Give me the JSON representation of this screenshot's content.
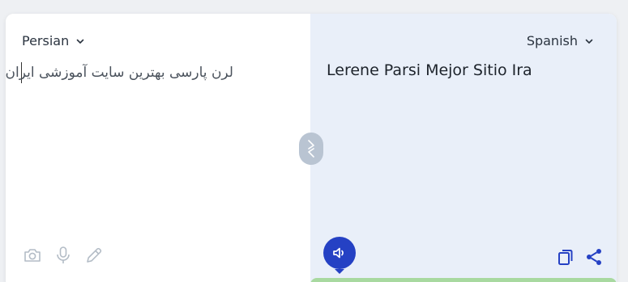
{
  "source": {
    "language": "Persian",
    "text": "لرن پارسی بهترین سایت آموزشی ایران",
    "tools": [
      "camera-icon",
      "microphone-icon",
      "pencil-icon"
    ]
  },
  "target": {
    "language": "Spanish",
    "text": "Lerene Parsi Mejor Sitio Ira"
  },
  "colors": {
    "accent": "#2541c4",
    "target_bg": "#e9eff9",
    "swap_bg": "#b9c4d2",
    "status_green": "#a8d9a0"
  }
}
